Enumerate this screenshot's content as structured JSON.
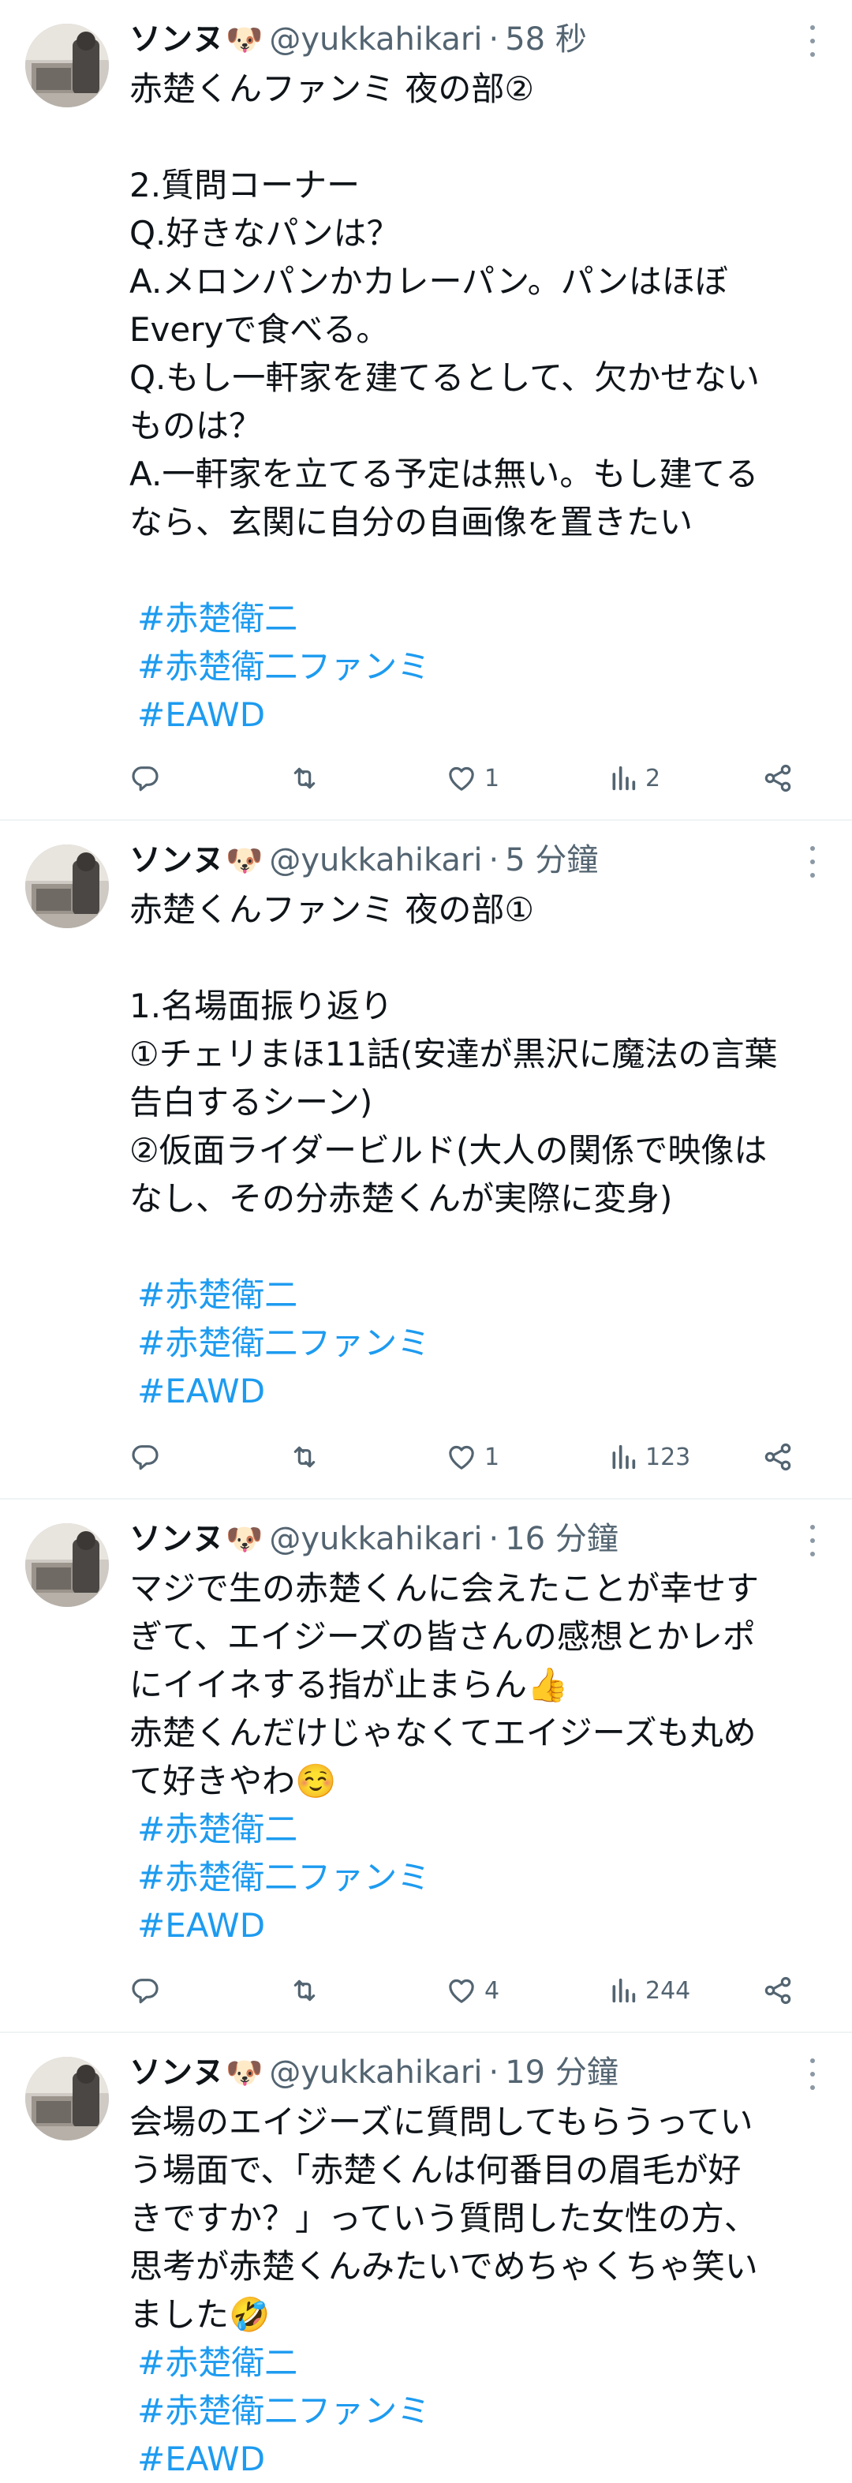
{
  "tweets": [
    {
      "name": "ソンヌ",
      "name_emoji": "🐶",
      "handle": "@yukkahikari",
      "separator": "·",
      "time": "58 秒",
      "lines": [
        "赤楚くんファンミ 夜の部②",
        "",
        "2.質問コーナー",
        "Q.好きなパンは？",
        "A.メロンパンかカレーパン。パンはほぼ",
        "Everyで食べる。",
        "Q.もし一軒家を建てるとして、欠かせない",
        "ものは？",
        "A.一軒家を立てる予定は無い。もし建てる",
        "なら、玄関に自分の自画像を置きたい",
        ""
      ],
      "hashtags": [
        "#赤楚衛二",
        "#赤楚衛二ファンミ",
        "#EAWD"
      ],
      "reply_count": "",
      "retweet_count": "",
      "like_count": "1",
      "view_count": "2"
    },
    {
      "name": "ソンヌ",
      "name_emoji": "🐶",
      "handle": "@yukkahikari",
      "separator": "·",
      "time": "5 分鐘",
      "lines": [
        "赤楚くんファンミ 夜の部①",
        "",
        "1.名場面振り返り",
        "①チェリまほ11話(安達が黒沢に魔法の言葉",
        "告白するシーン)",
        "②仮面ライダービルド(大人の関係で映像は",
        "なし、その分赤楚くんが実際に変身)",
        ""
      ],
      "hashtags": [
        "#赤楚衛二",
        "#赤楚衛二ファンミ",
        "#EAWD"
      ],
      "reply_count": "",
      "retweet_count": "",
      "like_count": "1",
      "view_count": "123"
    },
    {
      "name": "ソンヌ",
      "name_emoji": "🐶",
      "handle": "@yukkahikari",
      "separator": "·",
      "time": "16 分鐘",
      "lines": [
        "マジで生の赤楚くんに会えたことが幸せす",
        "ぎて、エイジーズの皆さんの感想とかレポ",
        "にイイネする指が止まらん👍",
        "赤楚くんだけじゃなくてエイジーズも丸め",
        "て好きやわ☺️"
      ],
      "hashtags": [
        "#赤楚衛二",
        "#赤楚衛二ファンミ",
        "#EAWD"
      ],
      "reply_count": "",
      "retweet_count": "",
      "like_count": "4",
      "view_count": "244"
    },
    {
      "name": "ソンヌ",
      "name_emoji": "🐶",
      "handle": "@yukkahikari",
      "separator": "·",
      "time": "19 分鐘",
      "lines": [
        "会場のエイジーズに質問してもらうってい",
        "う場面で、「赤楚くんは何番目の眉毛が好",
        "きですか？」っていう質問した女性の方、",
        "思考が赤楚くんみたいでめちゃくちゃ笑い",
        "ました🤣"
      ],
      "hashtags": [
        "#赤楚衛二",
        "#赤楚衛二ファンミ",
        "#EAWD"
      ],
      "reply_count": "",
      "retweet_count": "",
      "like_count": "",
      "view_count": ""
    }
  ],
  "icons": {
    "reply": "reply-icon",
    "retweet": "retweet-icon",
    "like": "heart-icon",
    "views": "views-icon",
    "share": "share-icon",
    "more": "more-icon"
  },
  "colors": {
    "hashtag": "#1d9bf0",
    "secondary_text": "#536471",
    "divider": "#eff3f4"
  }
}
